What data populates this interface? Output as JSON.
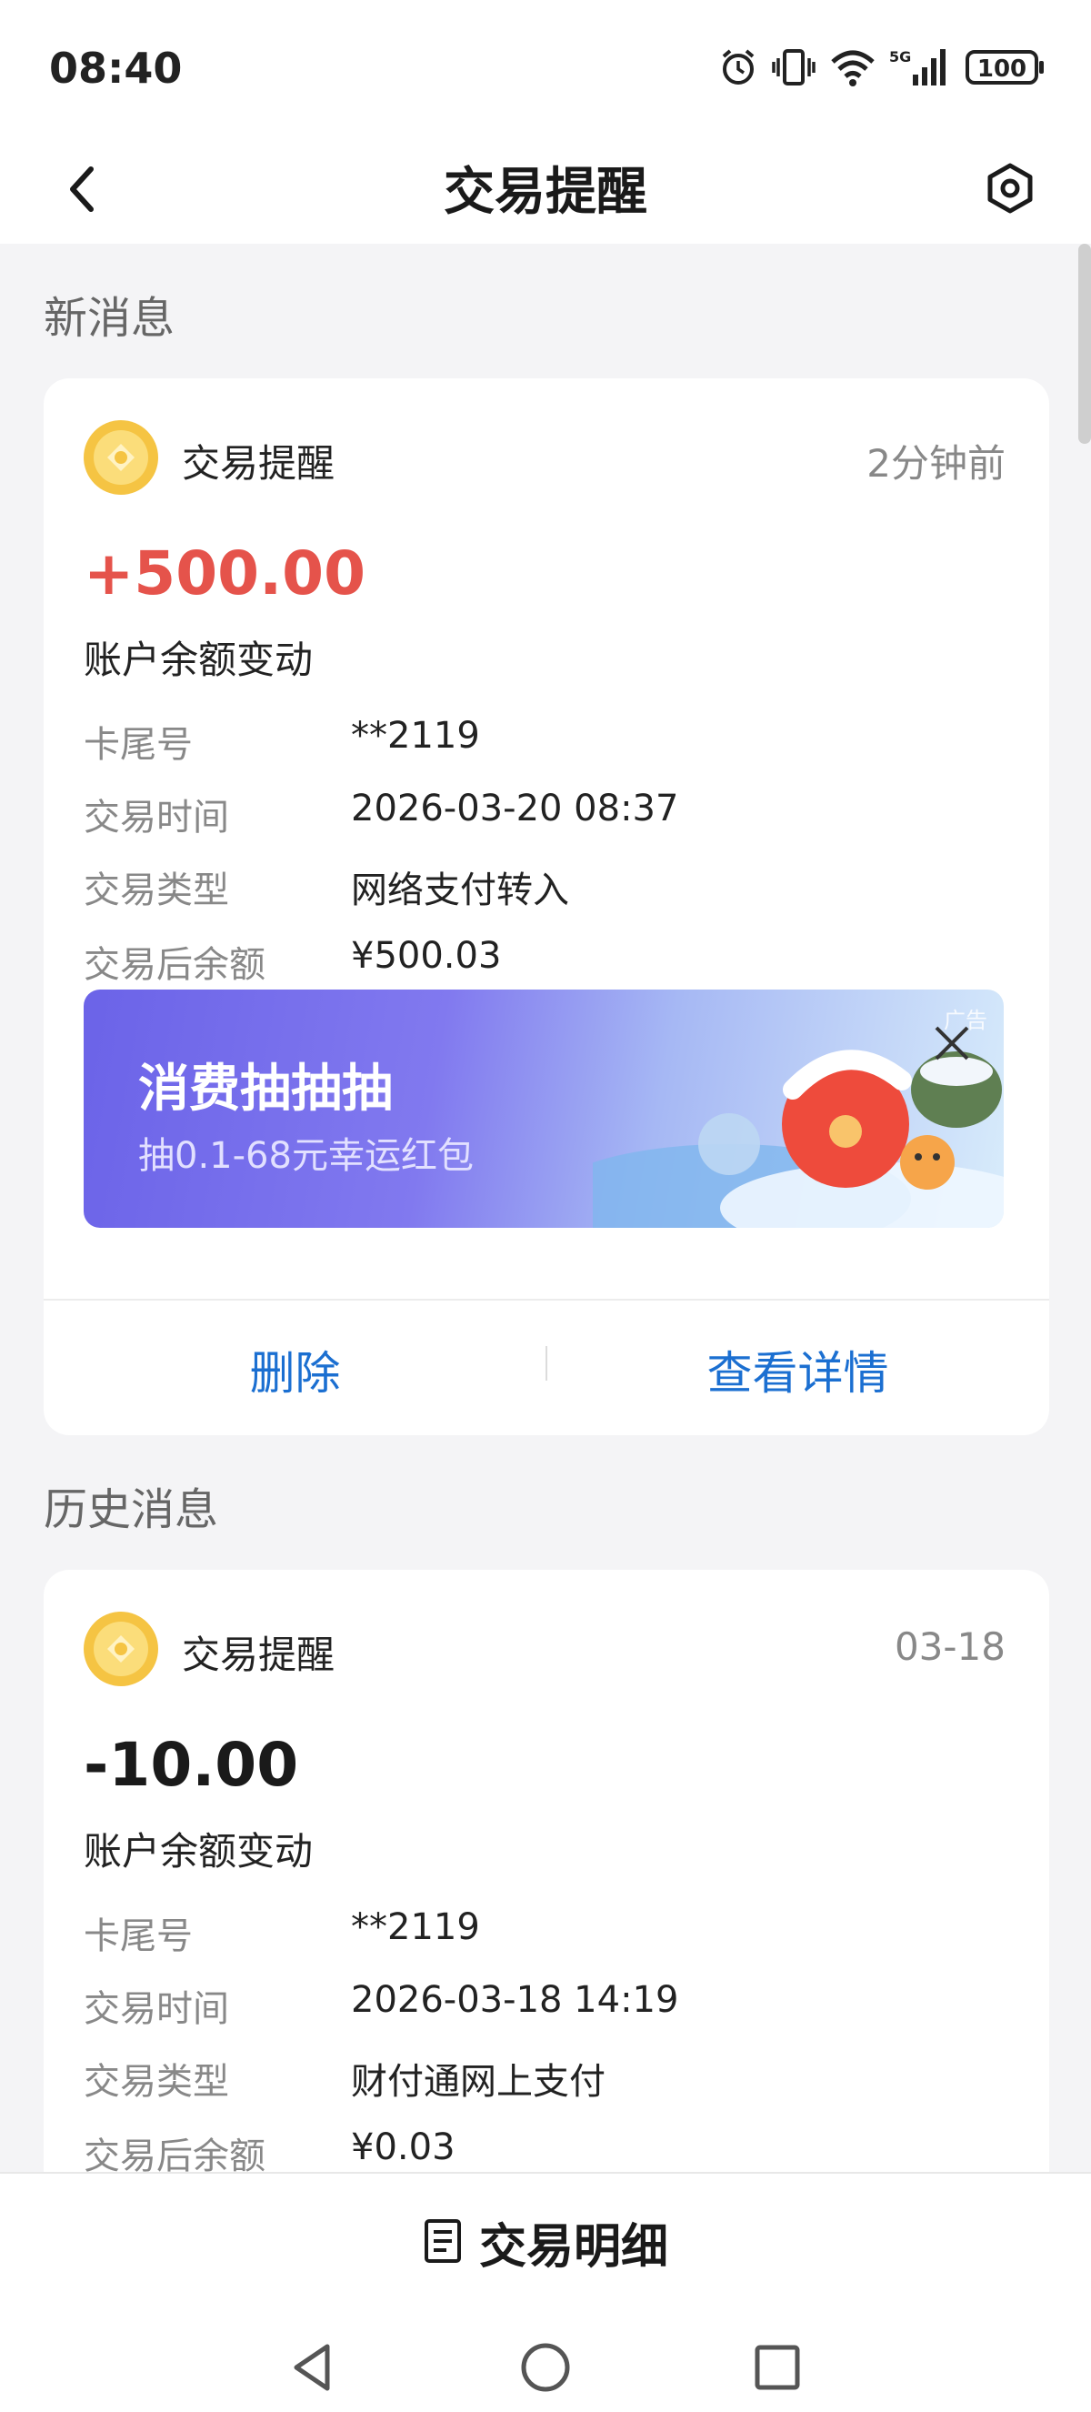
{
  "status_bar": {
    "time": "08:40",
    "battery": "100",
    "network": "5G"
  },
  "header": {
    "title": "交易提醒"
  },
  "sections": {
    "new": "新消息",
    "history": "历史消息"
  },
  "cards": [
    {
      "label": "交易提醒",
      "time": "2分钟前",
      "amount": "+500.00",
      "subtitle": "账户余额变动",
      "rows": [
        {
          "key": "卡尾号",
          "value": "**2119"
        },
        {
          "key": "交易时间",
          "value": "2026-03-20 08:37"
        },
        {
          "key": "交易类型",
          "value": "网络支付转入"
        },
        {
          "key": "交易后余额",
          "value": "¥500.03"
        }
      ],
      "ad": {
        "title": "消费抽抽抽",
        "subtitle": "抽0.1-68元幸运红包",
        "tag": "广告"
      },
      "actions": {
        "delete": "删除",
        "details": "查看详情"
      }
    },
    {
      "label": "交易提醒",
      "time": "03-18",
      "amount": "-10.00",
      "subtitle": "账户余额变动",
      "rows": [
        {
          "key": "卡尾号",
          "value": "**2119"
        },
        {
          "key": "交易时间",
          "value": "2026-03-18 14:19"
        },
        {
          "key": "交易类型",
          "value": "财付通网上支付"
        },
        {
          "key": "交易后余额",
          "value": "¥0.03"
        }
      ]
    }
  ],
  "bottom": {
    "detail_label": "交易明细"
  },
  "colors": {
    "positive": "#e5534b",
    "link": "#1b6fd1",
    "coin": "#f5c443"
  }
}
